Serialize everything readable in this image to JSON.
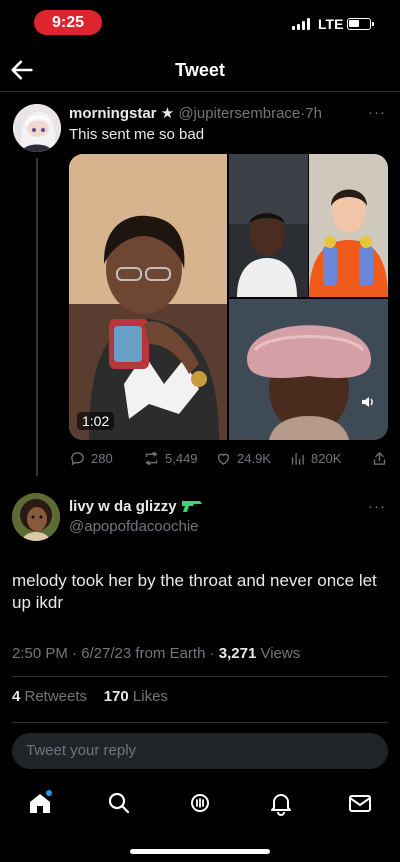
{
  "status_bar": {
    "time": "9:25",
    "network": "LTE"
  },
  "header": {
    "title": "Tweet"
  },
  "quoted_tweet": {
    "name": "morningstar",
    "star": "★",
    "handle": "@jupitersembrace",
    "time": "7h",
    "text": "This sent me so bad",
    "video_duration": "1:02",
    "replies": "280",
    "retweets": "5,449",
    "likes": "24.9K",
    "views": "820K"
  },
  "reply_tweet": {
    "name": "livy w da glizzy",
    "handle": "@apopofdacoochie",
    "text": "melody took her by the throat and never once let up ikdr",
    "timestamp": "2:50 PM · 6/27/23 from Earth · ",
    "views_count": "3,271",
    "views_label": " Views",
    "retweets_count": "4",
    "retweets_label": " Retweets",
    "likes_count": "170",
    "likes_label": " Likes"
  },
  "reply_box": {
    "placeholder": "Tweet your reply"
  },
  "icons": {
    "back": "arrow-left-icon",
    "more": "more-dots-icon",
    "reply": "reply-icon",
    "retweet": "retweet-icon",
    "like": "heart-icon",
    "views": "bar-chart-icon",
    "share": "share-icon",
    "home": "home-icon",
    "search": "search-icon",
    "spaces": "spaces-icon",
    "notifications": "bell-icon",
    "messages": "mail-icon"
  },
  "colors": {
    "background": "#000000",
    "text": "#e7e9ea",
    "muted": "#71767b",
    "accent": "#1d9bf0",
    "time_pill": "#e0242d"
  }
}
